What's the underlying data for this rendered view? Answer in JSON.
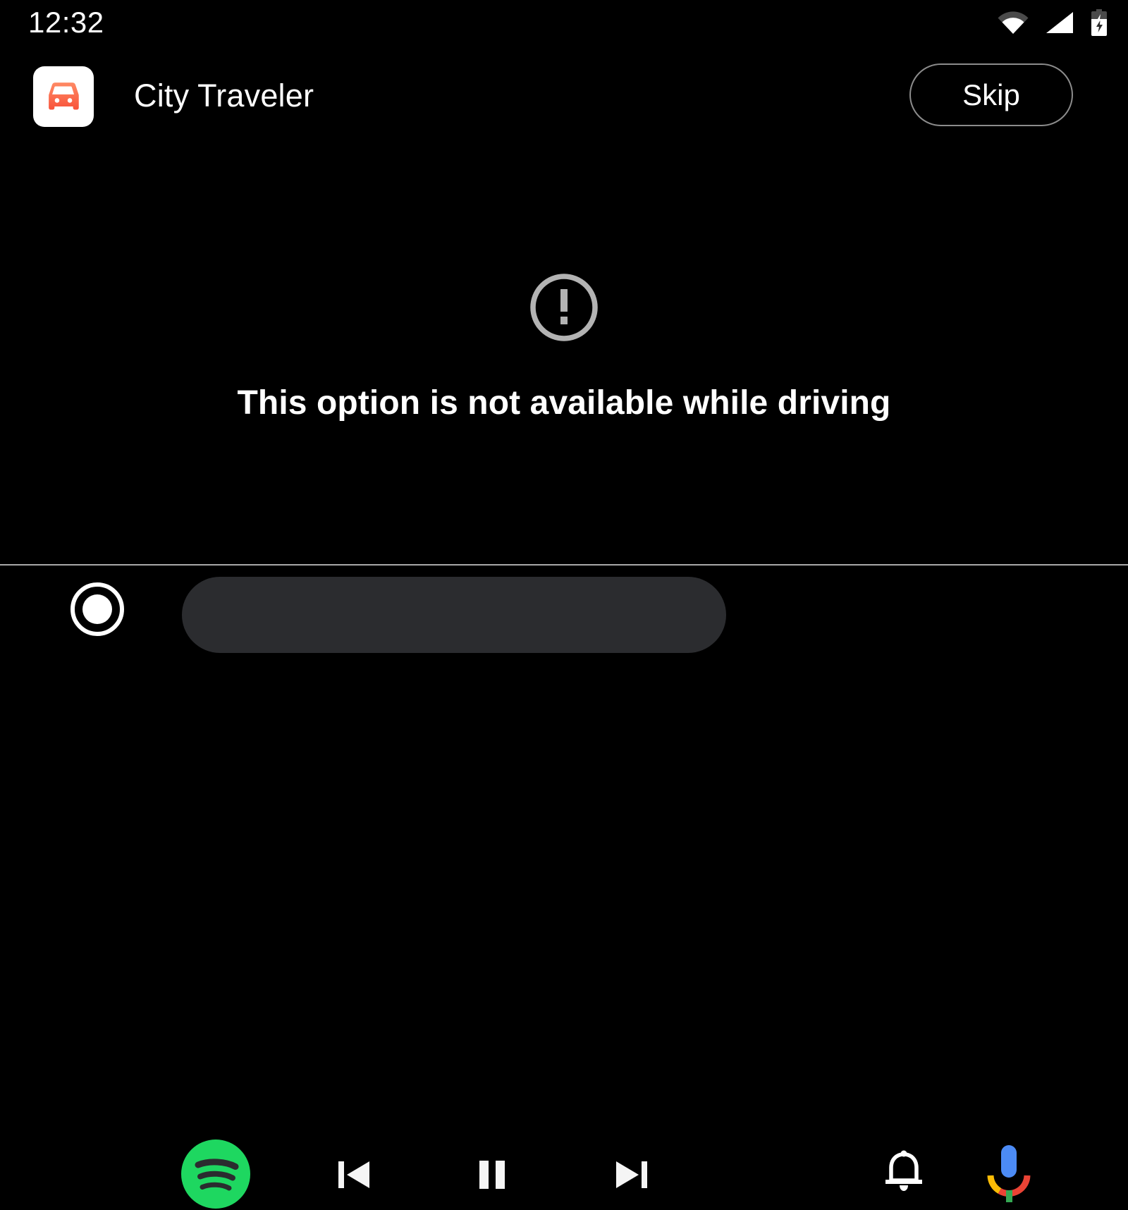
{
  "status_bar": {
    "clock": "12:32",
    "icons": [
      {
        "name": "wifi-icon",
        "label": "Wi-Fi"
      },
      {
        "name": "cellular-signal-icon",
        "label": "Cellular signal"
      },
      {
        "name": "battery-charging-icon",
        "label": "Battery charging"
      }
    ]
  },
  "app_header": {
    "icon_name": "car-app-icon",
    "icon_color": "#fa6a4e",
    "icon_background": "#ffffff",
    "title": "City Traveler",
    "skip_label": "Skip"
  },
  "content": {
    "icon_name": "error-outline-icon",
    "icon_color": "#b3b3b3",
    "message": "This option is not available while driving"
  },
  "nav_bar": {
    "home_label": "Home",
    "media_app": {
      "name": "spotify-icon",
      "label": "Spotify",
      "brand_color": "#1ed760"
    },
    "controls": [
      {
        "name": "skip-previous-button",
        "label": "Previous"
      },
      {
        "name": "pause-button",
        "label": "Pause"
      },
      {
        "name": "skip-next-button",
        "label": "Next"
      }
    ],
    "notifications_label": "Notifications",
    "assistant_label": "Google Assistant",
    "pill_color": "#2b2c2f"
  },
  "theme": {
    "background": "#000000",
    "text": "#ffffff",
    "divider": "#a8a8a8",
    "outline": "#8c8c8c"
  }
}
